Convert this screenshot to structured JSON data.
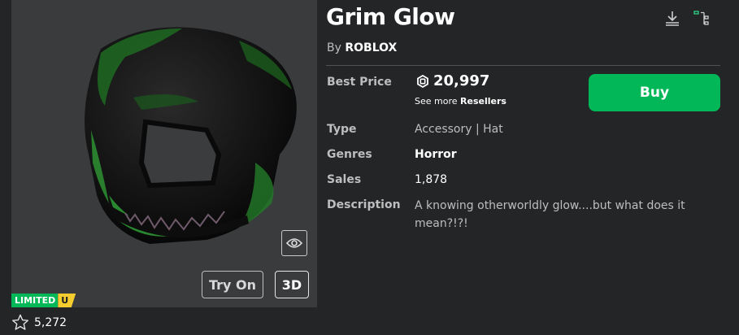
{
  "item": {
    "title": "Grim Glow",
    "by_prefix": "By",
    "creator": "ROBLOX",
    "favorites": "5,272",
    "limited_label": "LIMITED",
    "limited_u": "U"
  },
  "thumbnail": {
    "try_on_label": "Try On",
    "three_d_label": "3D"
  },
  "details": {
    "best_price_label": "Best Price",
    "best_price_value": "20,997",
    "see_more_prefix": "See more",
    "resellers_link": "Resellers",
    "buy_label": "Buy",
    "type_label": "Type",
    "type_value": "Accessory | Hat",
    "genres_label": "Genres",
    "genres_value": "Horror",
    "sales_label": "Sales",
    "sales_value": "1,878",
    "description_label": "Description",
    "description_value": "A knowing otherworldly glow....but what does it mean?!?!"
  },
  "icons": [
    "download-icon",
    "hierarchy-icon",
    "eye-icon",
    "star-icon",
    "robux-icon"
  ],
  "colors": {
    "buy_green": "#02b757",
    "limited_yellow": "#f5cd2f",
    "background": "#232527"
  }
}
